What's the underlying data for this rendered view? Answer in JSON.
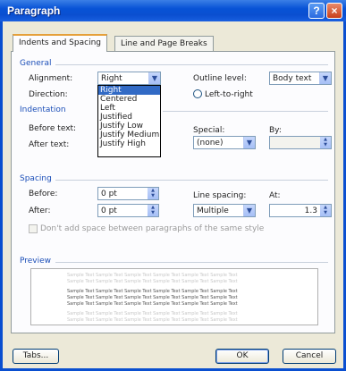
{
  "window": {
    "title": "Paragraph"
  },
  "tabs": [
    {
      "label": "Indents and Spacing",
      "active": true
    },
    {
      "label": "Line and Page Breaks",
      "active": false
    }
  ],
  "general": {
    "heading": "General",
    "alignment_label": "Alignment:",
    "alignment_value": "Right",
    "direction_label": "Direction:",
    "outline_label": "Outline level:",
    "outline_value": "Body text",
    "ltr_label": "Left-to-right",
    "alignment_options": [
      "Right",
      "Centered",
      "Left",
      "Justified",
      "Justify Low",
      "Justify Medium",
      "Justify High"
    ],
    "alignment_selected_index": 0
  },
  "indentation": {
    "heading": "Indentation",
    "before_label": "Before text:",
    "after_label": "After text:",
    "special_label": "Special:",
    "special_value": "(none)",
    "by_label": "By:"
  },
  "spacing": {
    "heading": "Spacing",
    "before_label": "Before:",
    "before_value": "0 pt",
    "after_label": "After:",
    "after_value": "0 pt",
    "line_spacing_label": "Line spacing:",
    "line_spacing_value": "Multiple",
    "at_label": "At:",
    "at_value": "1.3",
    "dont_add_label": "Don't add space between paragraphs of the same style"
  },
  "preview": {
    "heading": "Preview",
    "sample_text": "Sample Text Sample Text Sample Text Sample Text Sample Text Sample Text"
  },
  "buttons": {
    "tabs": "Tabs...",
    "ok": "OK",
    "cancel": "Cancel"
  },
  "colors": {
    "title_bar": "#0a4fd0",
    "section_heading": "#1c4fb8",
    "selection": "#316ac5"
  }
}
